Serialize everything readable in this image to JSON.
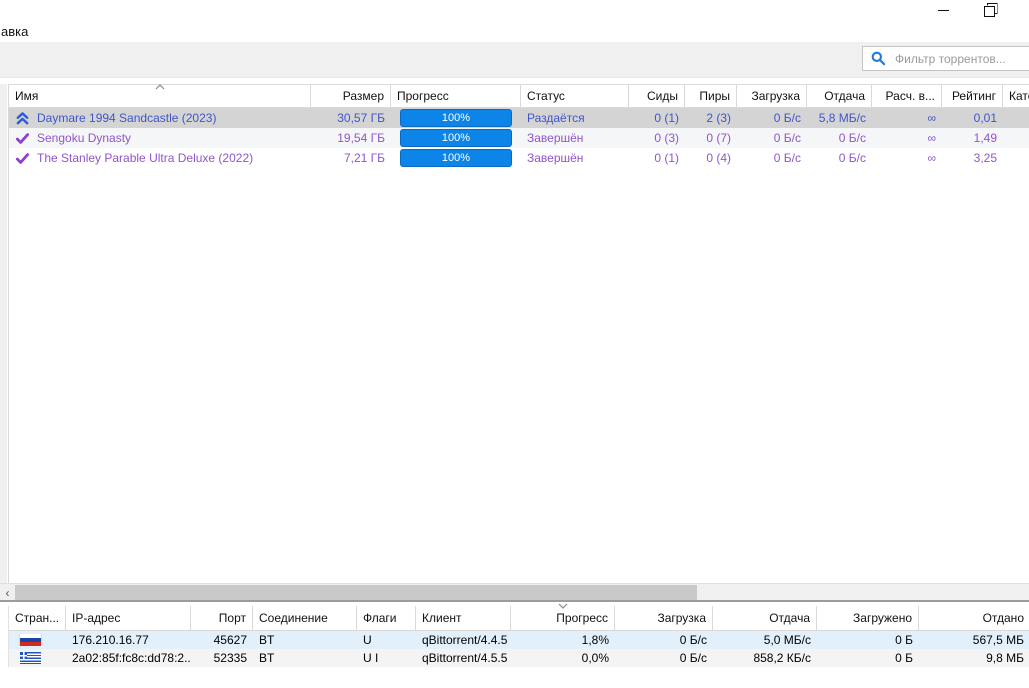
{
  "window": {
    "menu_partial": "авка",
    "minimize_label": "minimize",
    "restore_label": "restore"
  },
  "toolbar": {
    "filter_placeholder": "Фильтр торрентов..."
  },
  "colors": {
    "progress_fill": "#0d85e8",
    "seeding_text": "#4055c8",
    "completed_text": "#9155cc",
    "selected_row_bg": "#d4d4d4",
    "search_icon_blue": "#1e78e0",
    "peer_row_highlight": "#e2f0fb"
  },
  "torrents": {
    "columns": [
      "Имя",
      "Размер",
      "Прогресс",
      "Статус",
      "Сиды",
      "Пиры",
      "Загрузка",
      "Отдача",
      "Расч. в...",
      "Рейтинг",
      "Кате"
    ],
    "sort_column": "Имя",
    "sort_direction": "asc",
    "rows": [
      {
        "name": "Daymare 1994 Sandcastle (2023)",
        "size": "30,57 ГБ",
        "progress": "100%",
        "status": "Раздаётся",
        "seeds": "0 (1)",
        "peers": "2 (3)",
        "dl_speed": "0 Б/с",
        "up_speed": "5,8 МБ/с",
        "eta": "∞",
        "ratio": "0,01",
        "category": "",
        "state_icon": "seeding",
        "selected": true
      },
      {
        "name": "Sengoku Dynasty",
        "size": "19,54 ГБ",
        "progress": "100%",
        "status": "Завершён",
        "seeds": "0 (3)",
        "peers": "0 (7)",
        "dl_speed": "0 Б/с",
        "up_speed": "0 Б/с",
        "eta": "∞",
        "ratio": "1,49",
        "category": "",
        "state_icon": "completed",
        "selected": false
      },
      {
        "name": "The Stanley Parable Ultra Deluxe (2022)",
        "size": "7,21 ГБ",
        "progress": "100%",
        "status": "Завершён",
        "seeds": "0 (1)",
        "peers": "0 (4)",
        "dl_speed": "0 Б/с",
        "up_speed": "0 Б/с",
        "eta": "∞",
        "ratio": "3,25",
        "category": "",
        "state_icon": "completed",
        "selected": false
      }
    ]
  },
  "peers": {
    "columns": [
      "Стран...",
      "IP-адрес",
      "Порт",
      "Соединение",
      "Флаги",
      "Клиент",
      "Прогресс",
      "Загрузка",
      "Отдача",
      "Загружено",
      "Отдано"
    ],
    "sort_column": "Прогресс",
    "sort_direction": "desc",
    "rows": [
      {
        "country_flag": "russia",
        "ip": "176.210.16.77",
        "port": "45627",
        "connection": "BT",
        "flags": "U",
        "client": "qBittorrent/4.4.5",
        "progress": "1,8%",
        "dl_speed": "0 Б/с",
        "up_speed": "5,0 МБ/с",
        "downloaded": "0 Б",
        "uploaded": "567,5 МБ"
      },
      {
        "country_flag": "greece",
        "ip": "2a02:85f:fc8c:dd78:2...",
        "port": "52335",
        "connection": "BT",
        "flags": "U I",
        "client": "qBittorrent/4.5.5",
        "progress": "0,0%",
        "dl_speed": "0 Б/с",
        "up_speed": "858,2 КБ/с",
        "downloaded": "0 Б",
        "uploaded": "9,8 МБ"
      }
    ]
  }
}
